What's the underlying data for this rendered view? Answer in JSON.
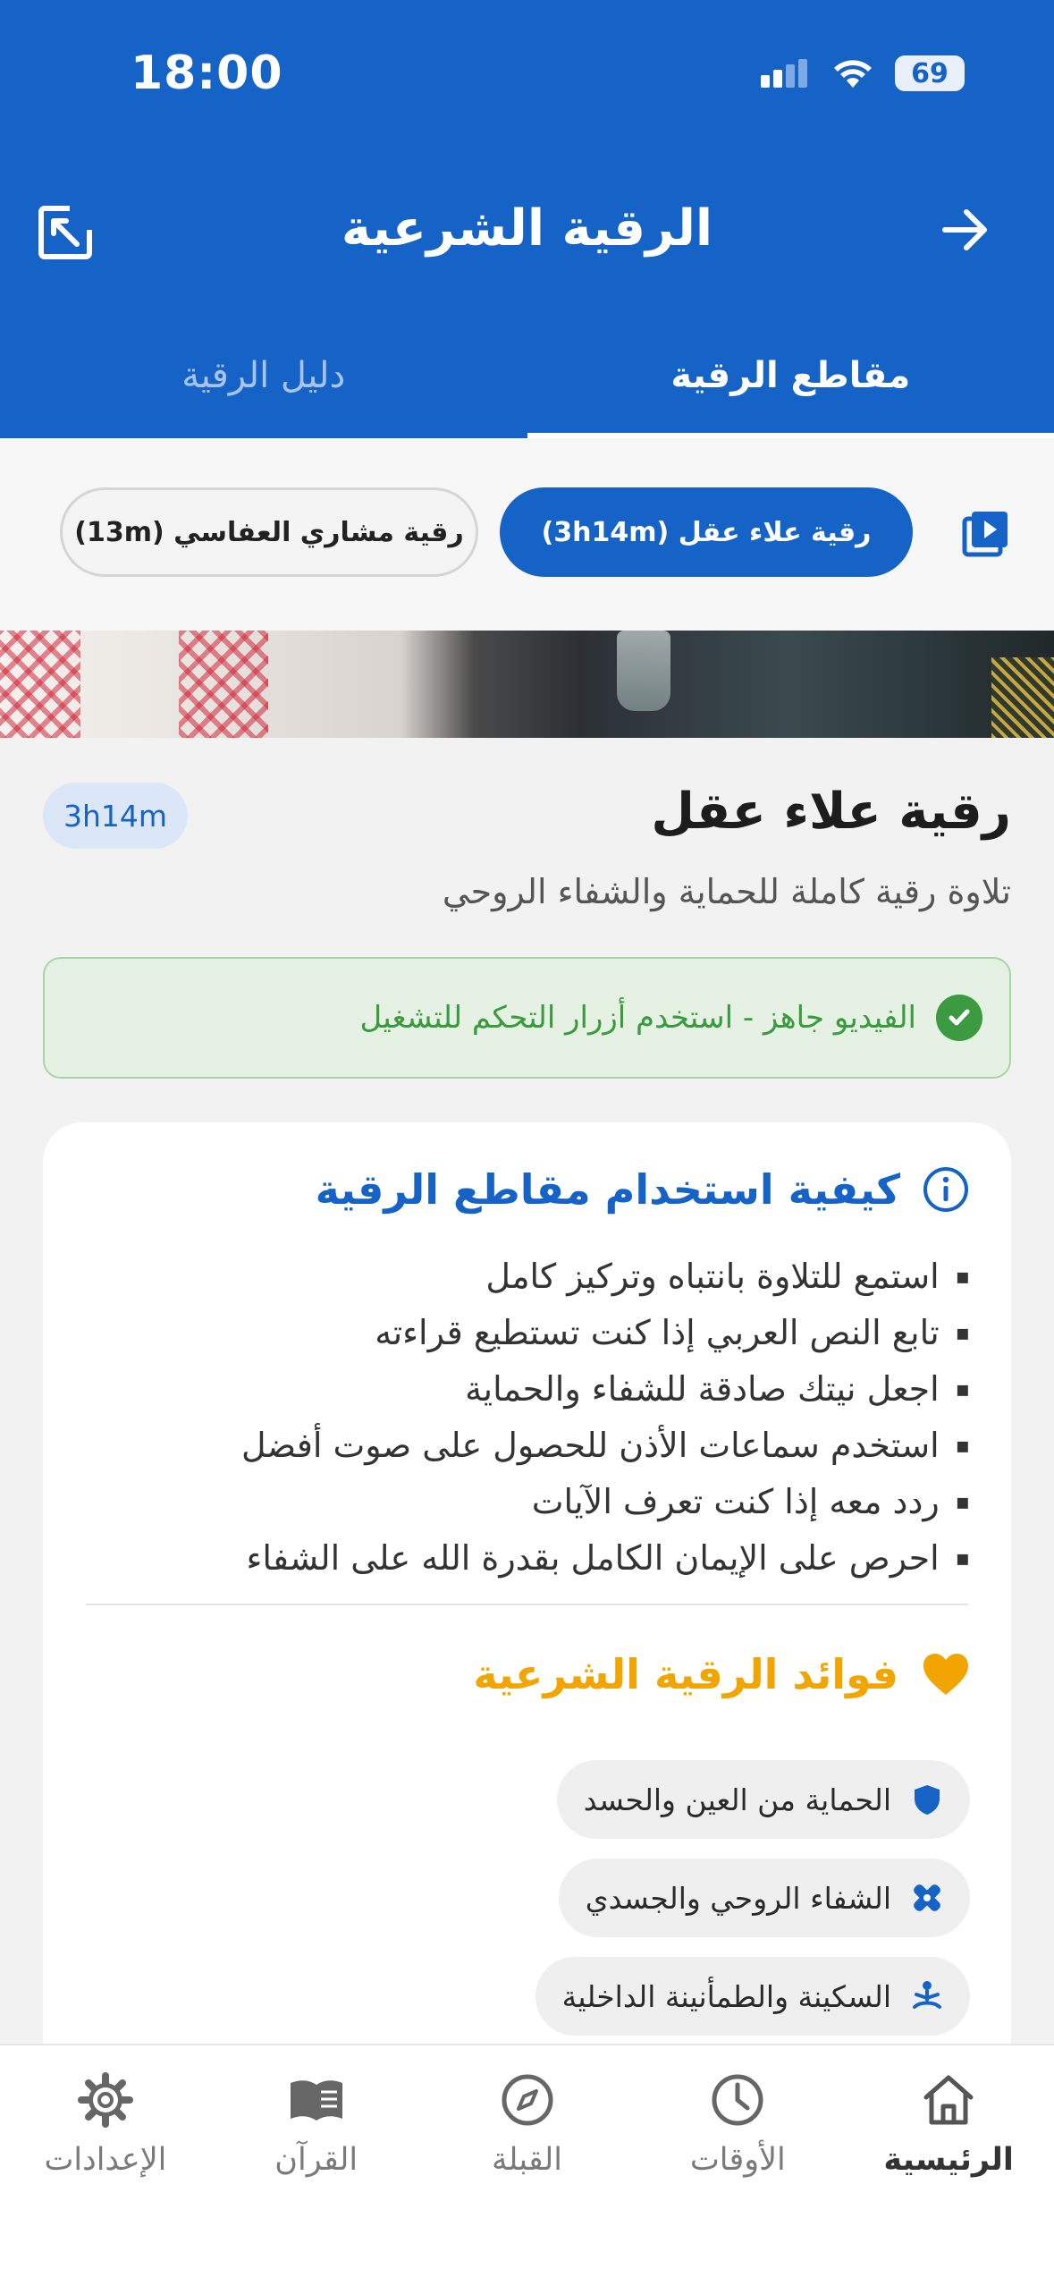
{
  "status_bar": {
    "time": "18:00",
    "battery": "69"
  },
  "app_bar": {
    "title": "الرقية الشرعية"
  },
  "tabs": [
    {
      "label": "مقاطع الرقية",
      "active": true
    },
    {
      "label": "دليل الرقية",
      "active": false
    }
  ],
  "chips": [
    {
      "label": "رقية علاء عقل (3h14m)",
      "selected": true
    },
    {
      "label": "رقية مشاري العفاسي (13m)",
      "selected": false
    }
  ],
  "video": {
    "title": "رقية علاء عقل",
    "duration": "3h14m",
    "description": "تلاوة رقية كاملة للحماية والشفاء الروحي",
    "ready_message": "الفيديو جاهز - استخدم أزرار التحكم للتشغيل"
  },
  "how_to": {
    "heading": "كيفية استخدام مقاطع الرقية",
    "tips": [
      "استمع للتلاوة بانتباه وتركيز كامل",
      "تابع النص العربي إذا كنت تستطيع قراءته",
      "اجعل نيتك صادقة للشفاء والحماية",
      "استخدم سماعات الأذن للحصول على صوت أفضل",
      "ردد معه إذا كنت تعرف الآيات",
      "احرص على الإيمان الكامل بقدرة الله على الشفاء"
    ]
  },
  "benefits": {
    "heading": "فوائد الرقية الشرعية",
    "items": [
      {
        "label": "الحماية من العين والحسد",
        "icon": "shield-icon"
      },
      {
        "label": "الشفاء الروحي والجسدي",
        "icon": "bandage-icon"
      },
      {
        "label": "السكينة والطمأنينة الداخلية",
        "icon": "meditation-icon"
      }
    ]
  },
  "bottom_nav": [
    {
      "label": "الرئيسية",
      "icon": "home-icon",
      "active": true
    },
    {
      "label": "الأوقات",
      "icon": "clock-icon",
      "active": false
    },
    {
      "label": "القبلة",
      "icon": "compass-icon",
      "active": false
    },
    {
      "label": "القرآن",
      "icon": "book-icon",
      "active": false
    },
    {
      "label": "الإعدادات",
      "icon": "gear-icon",
      "active": false
    }
  ],
  "colors": {
    "primary": "#1663c7",
    "success": "#3a9a3e",
    "accent": "#f2a500"
  }
}
